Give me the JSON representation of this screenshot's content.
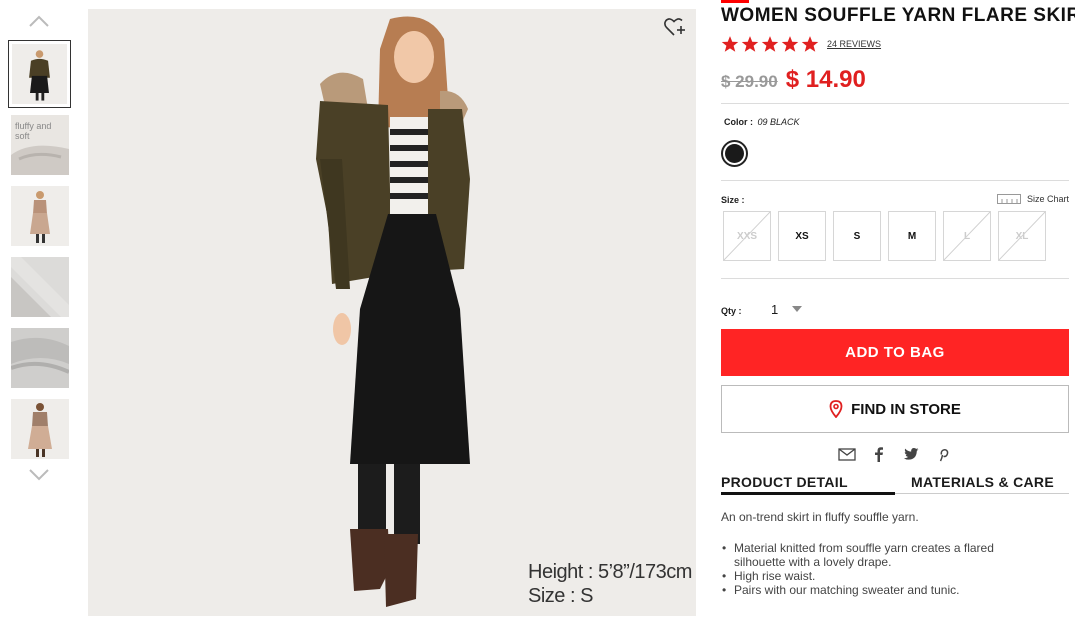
{
  "gallery": {
    "thumbnails": [
      {
        "name": "thumb-model-front",
        "text": ""
      },
      {
        "name": "thumb-fabric-closeup",
        "text": "fluffy and\nsoft"
      },
      {
        "name": "thumb-model-beige",
        "text": ""
      },
      {
        "name": "thumb-fabric-gray",
        "text": ""
      },
      {
        "name": "thumb-fabric-gray-2",
        "text": ""
      },
      {
        "name": "thumb-model-beige-back",
        "text": ""
      }
    ],
    "active_index": 0
  },
  "hero": {
    "model_height": "Height : 5’8”/173cm",
    "model_size": "Size : S"
  },
  "product": {
    "title": "WOMEN SOUFFLE YARN FLARE SKIRT",
    "rating": 5,
    "reviews": "24 REVIEWS",
    "price_old": "$ 29.90",
    "price_new": "$ 14.90"
  },
  "color": {
    "label": "Color :",
    "value": "09 BLACK",
    "swatch_hex": "#1a1a1a"
  },
  "size": {
    "label": "Size :",
    "chart_label": "Size Chart",
    "options": [
      {
        "label": "XXS",
        "available": false
      },
      {
        "label": "XS",
        "available": true
      },
      {
        "label": "S",
        "available": true
      },
      {
        "label": "M",
        "available": true
      },
      {
        "label": "L",
        "available": false
      },
      {
        "label": "XL",
        "available": false
      }
    ]
  },
  "quantity": {
    "label": "Qty :",
    "value": "1"
  },
  "actions": {
    "add_to_bag": "ADD TO BAG",
    "find_in_store": "FIND IN STORE"
  },
  "share": [
    "mail-icon",
    "facebook-icon",
    "twitter-icon",
    "pinterest-icon"
  ],
  "tabs": {
    "detail": "PRODUCT DETAIL",
    "materials": "MATERIALS & CARE"
  },
  "details": {
    "intro": "An on-trend skirt in fluffy souffle yarn.",
    "bullets": [
      "Material knitted from souffle yarn creates a flared silhouette with a lovely drape.",
      "High rise waist.",
      "Pairs with our matching sweater and tunic."
    ]
  },
  "colors": {
    "accent_red": "#ff2424",
    "price_red": "#e02020"
  }
}
